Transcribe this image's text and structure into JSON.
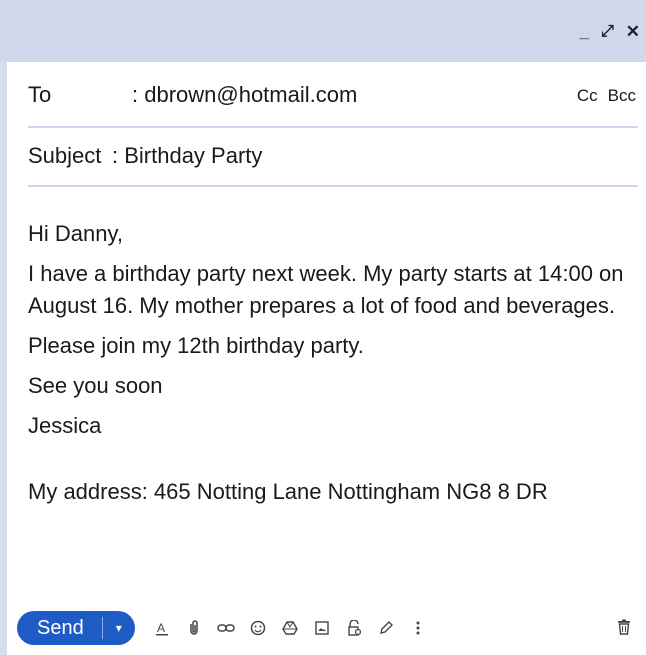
{
  "window": {
    "controls": {
      "minimize": "_",
      "expand": "⤢",
      "close": "✕"
    }
  },
  "header": {
    "to_label": "To",
    "to_value": ": dbrown@hotmail.com",
    "cc_label": "Cc",
    "bcc_label": "Bcc",
    "subject_label": "Subject",
    "subject_value": ": Birthday Party"
  },
  "body": {
    "greeting": "Hi Danny,",
    "paragraph1": "I have a birthday party next week. My party starts at 14:00 on August  16.  My mother  prepares a lot of food and beverages.",
    "paragraph2": "Please join my 12th birthday party.",
    "closing": "See you soon",
    "signature": "Jessica",
    "address": "My address: 465 Notting Lane Nottingham NG8 8 DR"
  },
  "toolbar": {
    "send_label": "Send",
    "send_options": "▾",
    "icons": [
      "text-format-icon",
      "attach-icon",
      "link-icon",
      "emoji-icon",
      "drive-icon",
      "image-icon",
      "lock-icon",
      "pen-icon",
      "more-icon"
    ],
    "trash": "trash-icon"
  },
  "colors": {
    "titlebar": "#cfd7ea",
    "accent": "#1f5bc4",
    "rule": "#cdd5ea"
  }
}
